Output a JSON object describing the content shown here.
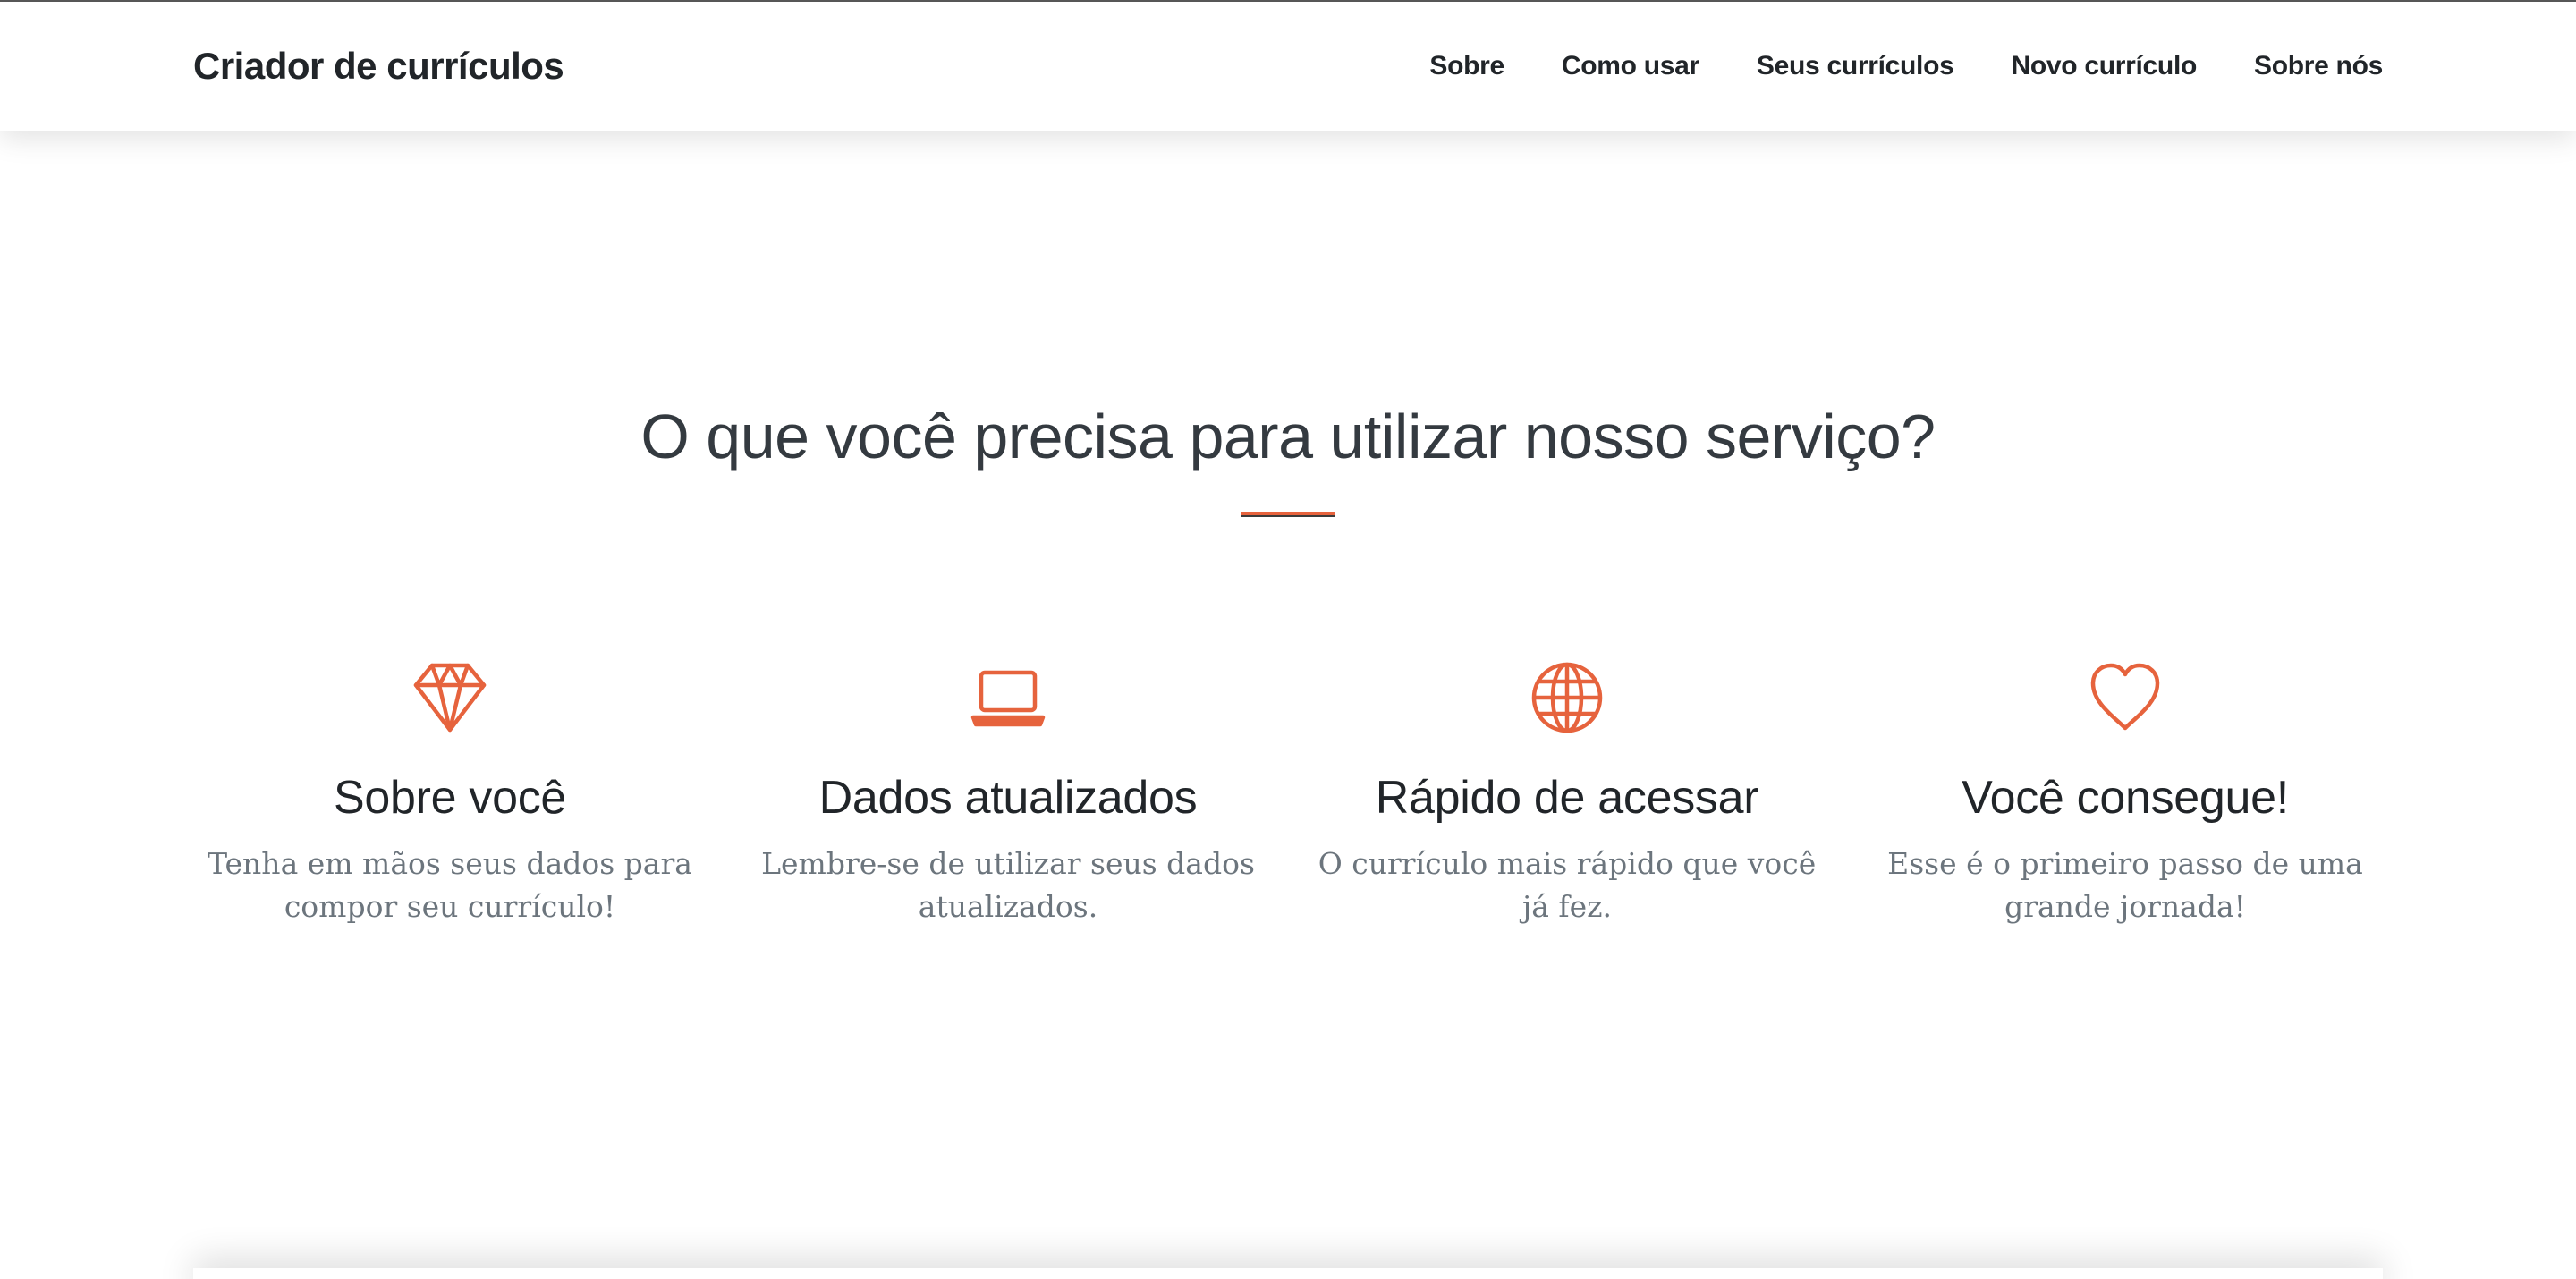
{
  "navbar": {
    "brand": "Criador de currículos",
    "links": [
      {
        "label": "Sobre"
      },
      {
        "label": "Como usar"
      },
      {
        "label": "Seus currículos"
      },
      {
        "label": "Novo currículo"
      },
      {
        "label": "Sobre nós"
      }
    ]
  },
  "section": {
    "title": "O que você precisa para utilizar nosso serviço?",
    "accent_color": "#e6633d",
    "features": [
      {
        "icon": "diamond-icon",
        "title": "Sobre você",
        "text": "Tenha em mãos seus dados para compor seu currículo!"
      },
      {
        "icon": "laptop-icon",
        "title": "Dados atualizados",
        "text": "Lembre-se de utilizar seus dados atualizados."
      },
      {
        "icon": "globe-icon",
        "title": "Rápido de acessar",
        "text": "O currículo mais rápido que você já fez."
      },
      {
        "icon": "heart-icon",
        "title": "Você consegue!",
        "text": "Esse é o primeiro passo de uma grande jornada!"
      }
    ]
  }
}
